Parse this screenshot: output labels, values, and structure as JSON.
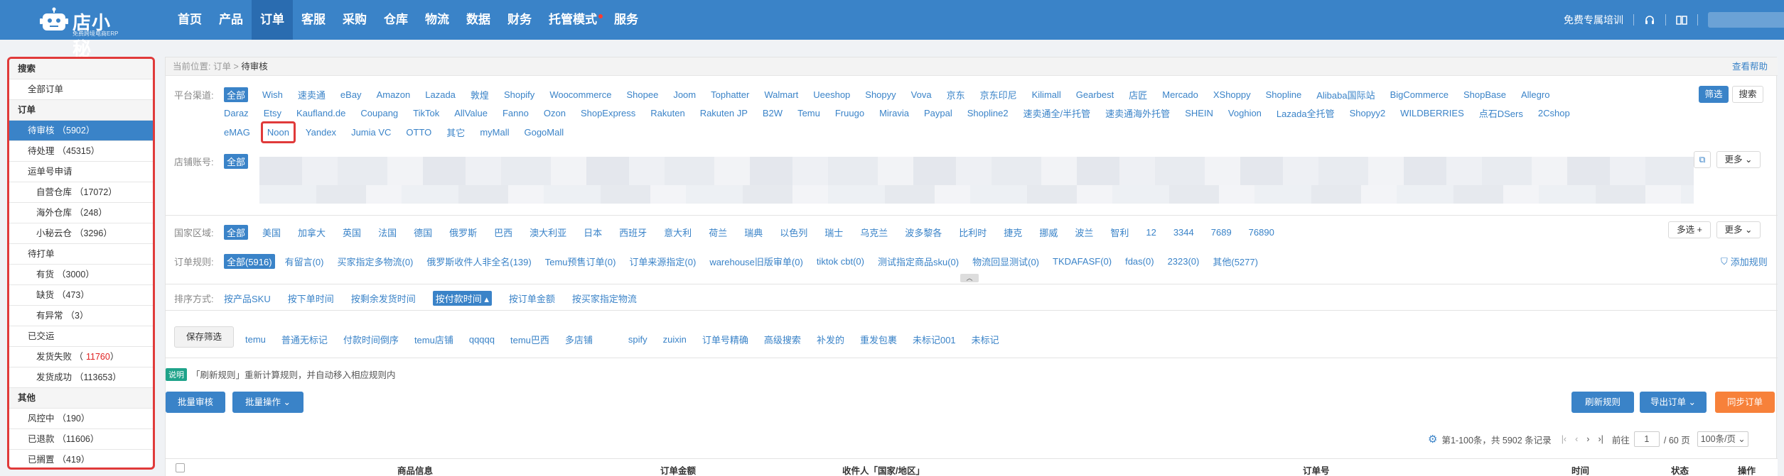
{
  "topbar": {
    "logo_text": "店小秘",
    "logo_sub": "免费跨境电商ERP",
    "nav": [
      "首页",
      "产品",
      "订单",
      "客服",
      "采购",
      "仓库",
      "物流",
      "数据",
      "财务",
      "托管模式",
      "服务"
    ],
    "active_nav": "订单",
    "training": "免费专属培训"
  },
  "sidebar": {
    "sections": [
      {
        "title": "搜索",
        "items": [
          {
            "label": "全部订单",
            "count": "",
            "level": 1
          }
        ]
      },
      {
        "title": "订单",
        "items": [
          {
            "label": "待审核",
            "count": "（5902）",
            "level": 1,
            "selected": true
          },
          {
            "label": "待处理",
            "count": "（45315）",
            "level": 1
          },
          {
            "label": "运单号申请",
            "count": "",
            "level": 1
          },
          {
            "label": "自营仓库",
            "count": "（17072）",
            "level": 2
          },
          {
            "label": "海外仓库",
            "count": "（248）",
            "level": 2
          },
          {
            "label": "小秘云仓",
            "count": "（3296）",
            "level": 2
          },
          {
            "label": "待打单",
            "count": "",
            "level": 1
          },
          {
            "label": "有货",
            "count": "（3000）",
            "level": 2
          },
          {
            "label": "缺货",
            "count": "（473）",
            "level": 2
          },
          {
            "label": "有异常",
            "count": "（3）",
            "level": 2
          },
          {
            "label": "已交运",
            "count": "",
            "level": 1
          },
          {
            "label": "发货失败",
            "count": "11760",
            "level": 2,
            "red": true
          },
          {
            "label": "发货成功",
            "count": "（113653）",
            "level": 2
          }
        ]
      },
      {
        "title": "其他",
        "items": [
          {
            "label": "风控中",
            "count": "（190）",
            "level": 1
          },
          {
            "label": "已退款",
            "count": "（11606）",
            "level": 1
          },
          {
            "label": "已搁置",
            "count": "（419）",
            "level": 1
          }
        ]
      }
    ]
  },
  "breadcrumb": {
    "prefix": "当前位置:",
    "parent": "订单",
    "sep": ">",
    "current": "待审核",
    "help": "查看帮助"
  },
  "platform": {
    "label": "平台渠道:",
    "rows": [
      [
        "全部",
        "Wish",
        "速卖通",
        "eBay",
        "Amazon",
        "Lazada",
        "敦煌",
        "Shopify",
        "Woocommerce",
        "Shopee",
        "Joom",
        "Tophatter",
        "Walmart",
        "Ueeshop",
        "Shopyy",
        "Vova",
        "京东",
        "京东印尼",
        "Kilimall",
        "Gearbest",
        "店匠",
        "Mercado",
        "XShoppy",
        "Shopline",
        "Alibaba国际站",
        "BigCommerce",
        "ShopBase",
        "Allegro"
      ],
      [
        "Daraz",
        "Etsy",
        "Kaufland.de",
        "Coupang",
        "TikTok",
        "AllValue",
        "Fanno",
        "Ozon",
        "ShopExpress",
        "Rakuten",
        "Rakuten JP",
        "B2W",
        "Temu",
        "Fruugo",
        "Miravia",
        "Paypal",
        "Shopline2",
        "速卖通全/半托管",
        "速卖通海外托管",
        "SHEIN",
        "Voghion",
        "Lazada全托管",
        "Shopyy2",
        "WILDBERRIES",
        "点石DSers",
        "2Cshop"
      ],
      [
        "eMAG",
        "Noon",
        "Yandex",
        "Jumia VC",
        "OTTO",
        "其它",
        "myMall",
        "GogoMall"
      ]
    ],
    "filter_btn": "筛选",
    "search_btn": "搜索"
  },
  "shop": {
    "label": "店铺账号:",
    "all": "全部",
    "more": "更多"
  },
  "country": {
    "label": "国家区域:",
    "items": [
      "全部",
      "美国",
      "加拿大",
      "英国",
      "法国",
      "德国",
      "俄罗斯",
      "巴西",
      "澳大利亚",
      "日本",
      "西班牙",
      "意大利",
      "荷兰",
      "瑞典",
      "以色列",
      "瑞士",
      "乌克兰",
      "波多黎各",
      "比利时",
      "捷克",
      "挪威",
      "波兰",
      "智利",
      "12",
      "3344",
      "7689",
      "76890"
    ],
    "multi": "多选",
    "more": "更多"
  },
  "rules": {
    "label": "订单规则:",
    "items": [
      "全部(5916)",
      "有留言(0)",
      "买家指定多物流(0)",
      "俄罗斯收件人非全名(139)",
      "Temu预售订单(0)",
      "订单来源指定(0)",
      "warehouse旧版审单(0)",
      "tiktok cbt(0)",
      "测试指定商品sku(0)",
      "物流回显测试(0)",
      "TKDAFASF(0)",
      "fdas(0)",
      "2323(0)",
      "其他(5277)"
    ],
    "add": "添加规则"
  },
  "sort": {
    "label": "排序方式:",
    "items": [
      "按产品SKU",
      "按下单时间",
      "按剩余发货时间",
      "按付款时间",
      "按订单金额",
      "按买家指定物流"
    ],
    "selected": "按付款时间"
  },
  "saved": {
    "button": "保存筛选",
    "items": [
      "temu",
      "普通无标记",
      "付款时间倒序",
      "temu店铺",
      "qqqqq",
      "temu巴西",
      "多店铺",
      "spify",
      "zuixin",
      "订单号精确",
      "高级搜索",
      "补发的",
      "重发包裹",
      "未标记001",
      "未标记"
    ]
  },
  "notice": {
    "tag": "说明",
    "text": "「刷新规则」重新计算规则，并自动移入相应规则内"
  },
  "actions": {
    "batch_review": "批量审核",
    "batch_ops": "批量操作",
    "refresh_rules": "刷新规则",
    "export": "导出订单",
    "sync": "同步订单"
  },
  "pager": {
    "summary": "第1-100条，共 5902 条记录",
    "goto": "前往",
    "page": "1",
    "total": "/ 60 页",
    "per_page": "100条/页"
  },
  "table": {
    "headers": [
      "商品信息",
      "订单金额",
      "收件人「国家/地区」",
      "订单号",
      "时间",
      "状态",
      "操作"
    ]
  }
}
